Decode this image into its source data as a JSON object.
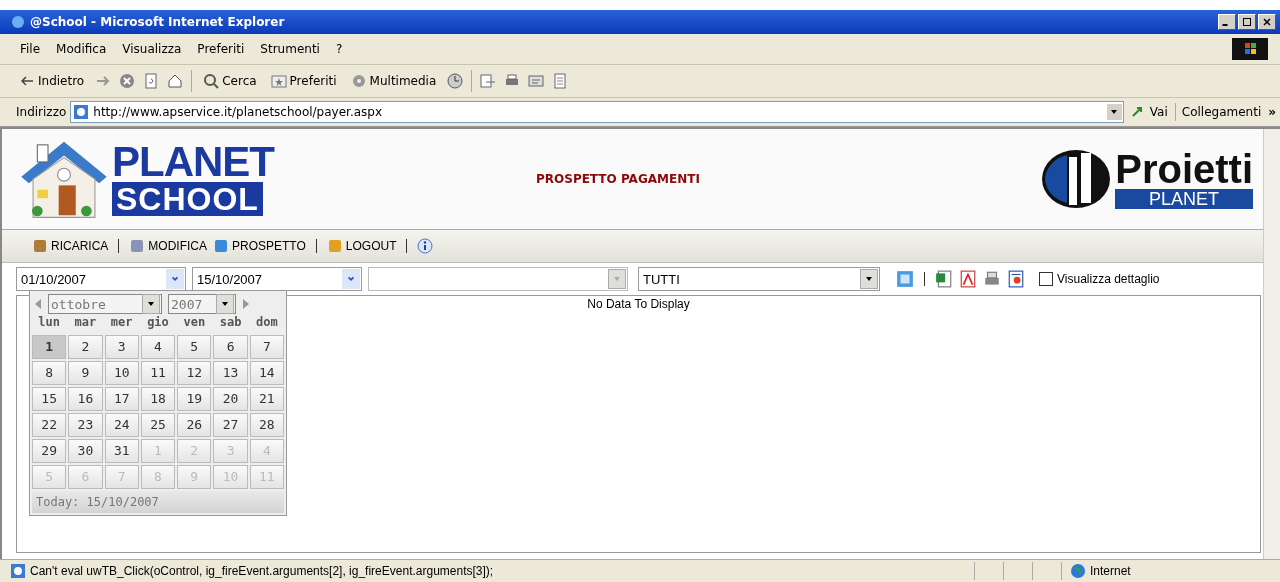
{
  "window": {
    "title": "@School - Microsoft Internet Explorer"
  },
  "menu": [
    "File",
    "Modifica",
    "Visualizza",
    "Preferiti",
    "Strumenti",
    "?"
  ],
  "browser_toolbar": {
    "back": "Indietro",
    "search": "Cerca",
    "favorites": "Preferiti",
    "media": "Multimedia"
  },
  "address_bar": {
    "label": "Indirizzo",
    "url": "http://www.apservice.it/planetschool/payer.aspx",
    "go": "Vai",
    "links": "Collegamenti",
    "more": "»"
  },
  "header": {
    "logo_top": "PLANET",
    "logo_bottom": "SCHOOL",
    "title": "PROSPETTO PAGAMENTI",
    "brand_top": "Proietti",
    "brand_bottom": "PLANET"
  },
  "app_toolbar": [
    {
      "label": "RICARICA",
      "kind": "reload"
    },
    {
      "label": "MODIFICA",
      "kind": "edit"
    },
    {
      "label": "PROSPETTO",
      "kind": "report"
    },
    {
      "label": "LOGOUT",
      "kind": "logout"
    }
  ],
  "filters": {
    "date_from": "01/10/2007",
    "date_to": "15/10/2007",
    "combo_disabled": true,
    "category": "TUTTI",
    "detail_label": "Visualizza dettaglio",
    "detail_checked": false
  },
  "report": {
    "empty_message": "No Data To Display"
  },
  "calendar": {
    "month": "ottobre",
    "year": "2007",
    "weekdays": [
      "lun",
      "mar",
      "mer",
      "gio",
      "ven",
      "sab",
      "dom"
    ],
    "weeks": [
      [
        {
          "label": "1",
          "other": false,
          "selected": true
        },
        {
          "label": "2",
          "other": false,
          "selected": false
        },
        {
          "label": "3",
          "other": false,
          "selected": false
        },
        {
          "label": "4",
          "other": false,
          "selected": false
        },
        {
          "label": "5",
          "other": false,
          "selected": false
        },
        {
          "label": "6",
          "other": false,
          "selected": false
        },
        {
          "label": "7",
          "other": false,
          "selected": false
        }
      ],
      [
        {
          "label": "8",
          "other": false,
          "selected": false
        },
        {
          "label": "9",
          "other": false,
          "selected": false
        },
        {
          "label": "10",
          "other": false,
          "selected": false
        },
        {
          "label": "11",
          "other": false,
          "selected": false
        },
        {
          "label": "12",
          "other": false,
          "selected": false
        },
        {
          "label": "13",
          "other": false,
          "selected": false
        },
        {
          "label": "14",
          "other": false,
          "selected": false
        }
      ],
      [
        {
          "label": "15",
          "other": false,
          "selected": false
        },
        {
          "label": "16",
          "other": false,
          "selected": false
        },
        {
          "label": "17",
          "other": false,
          "selected": false
        },
        {
          "label": "18",
          "other": false,
          "selected": false
        },
        {
          "label": "19",
          "other": false,
          "selected": false
        },
        {
          "label": "20",
          "other": false,
          "selected": false
        },
        {
          "label": "21",
          "other": false,
          "selected": false
        }
      ],
      [
        {
          "label": "22",
          "other": false,
          "selected": false
        },
        {
          "label": "23",
          "other": false,
          "selected": false
        },
        {
          "label": "24",
          "other": false,
          "selected": false
        },
        {
          "label": "25",
          "other": false,
          "selected": false
        },
        {
          "label": "26",
          "other": false,
          "selected": false
        },
        {
          "label": "27",
          "other": false,
          "selected": false
        },
        {
          "label": "28",
          "other": false,
          "selected": false
        }
      ],
      [
        {
          "label": "29",
          "other": false,
          "selected": false
        },
        {
          "label": "30",
          "other": false,
          "selected": false
        },
        {
          "label": "31",
          "other": false,
          "selected": false
        },
        {
          "label": "1",
          "other": true,
          "selected": false
        },
        {
          "label": "2",
          "other": true,
          "selected": false
        },
        {
          "label": "3",
          "other": true,
          "selected": false
        },
        {
          "label": "4",
          "other": true,
          "selected": false
        }
      ],
      [
        {
          "label": "5",
          "other": true,
          "selected": false
        },
        {
          "label": "6",
          "other": true,
          "selected": false
        },
        {
          "label": "7",
          "other": true,
          "selected": false
        },
        {
          "label": "8",
          "other": true,
          "selected": false
        },
        {
          "label": "9",
          "other": true,
          "selected": false
        },
        {
          "label": "10",
          "other": true,
          "selected": false
        },
        {
          "label": "11",
          "other": true,
          "selected": false
        }
      ]
    ],
    "today": "Today: 15/10/2007"
  },
  "status_bar": {
    "message": "Can't eval uwTB_Click(oControl, ig_fireEvent.arguments[2], ig_fireEvent.arguments[3]);",
    "zone": "Internet"
  }
}
